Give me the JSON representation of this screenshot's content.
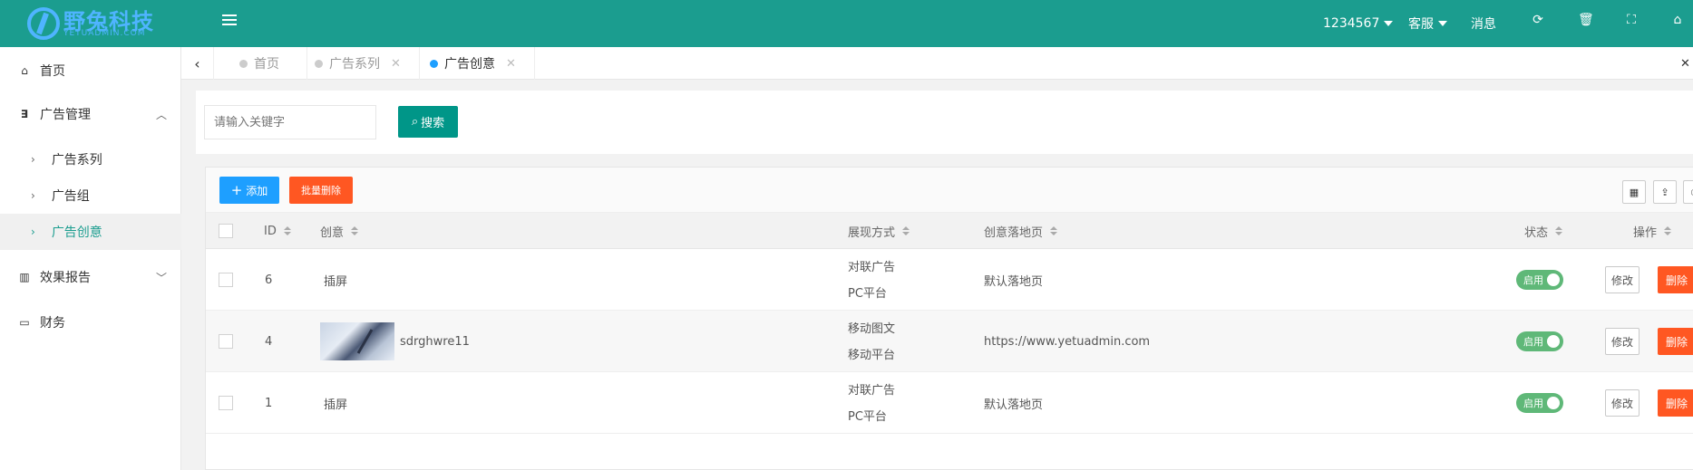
{
  "header": {
    "logo_text": "野兔科技",
    "logo_sub": "YETUADMIN.COM",
    "user": "1234567",
    "service": "客服",
    "messages": "消息",
    "icons": [
      "refresh-icon",
      "trash-icon",
      "fullscreen-icon",
      "home-icon"
    ]
  },
  "sidebar": {
    "items": [
      {
        "label": "首页",
        "icon": "home-icon"
      },
      {
        "label": "广告管理",
        "icon": "css3-icon"
      },
      {
        "label": "广告系列"
      },
      {
        "label": "广告组"
      },
      {
        "label": "广告创意"
      },
      {
        "label": "效果报告",
        "icon": "bar-chart-icon"
      },
      {
        "label": "财务",
        "icon": "credit-card-icon"
      }
    ]
  },
  "tabs": [
    {
      "label": "首页"
    },
    {
      "label": "广告系列"
    },
    {
      "label": "广告创意"
    }
  ],
  "search": {
    "placeholder": "请输入关键字",
    "button": "搜索"
  },
  "toolbar": {
    "add": "添加",
    "batch_delete": "批量删除"
  },
  "columns": {
    "id": "ID",
    "creative": "创意",
    "display": "展现方式",
    "landing": "创意落地页",
    "status": "状态",
    "actions": "操作"
  },
  "rows": [
    {
      "id": "6",
      "creative": "插屏",
      "display1": "对联广告",
      "display2": "PC平台",
      "landing": "默认落地页",
      "status": "启用",
      "edit": "修改",
      "delete": "删除"
    },
    {
      "id": "4",
      "creative": "sdrghwre11",
      "display1": "移动图文",
      "display2": "移动平台",
      "landing": "https://www.yetuadmin.com",
      "status": "启用",
      "edit": "修改",
      "delete": "删除"
    },
    {
      "id": "1",
      "creative": "插屏",
      "display1": "对联广告",
      "display2": "PC平台",
      "landing": "默认落地页",
      "status": "启用",
      "edit": "修改",
      "delete": "删除"
    }
  ]
}
